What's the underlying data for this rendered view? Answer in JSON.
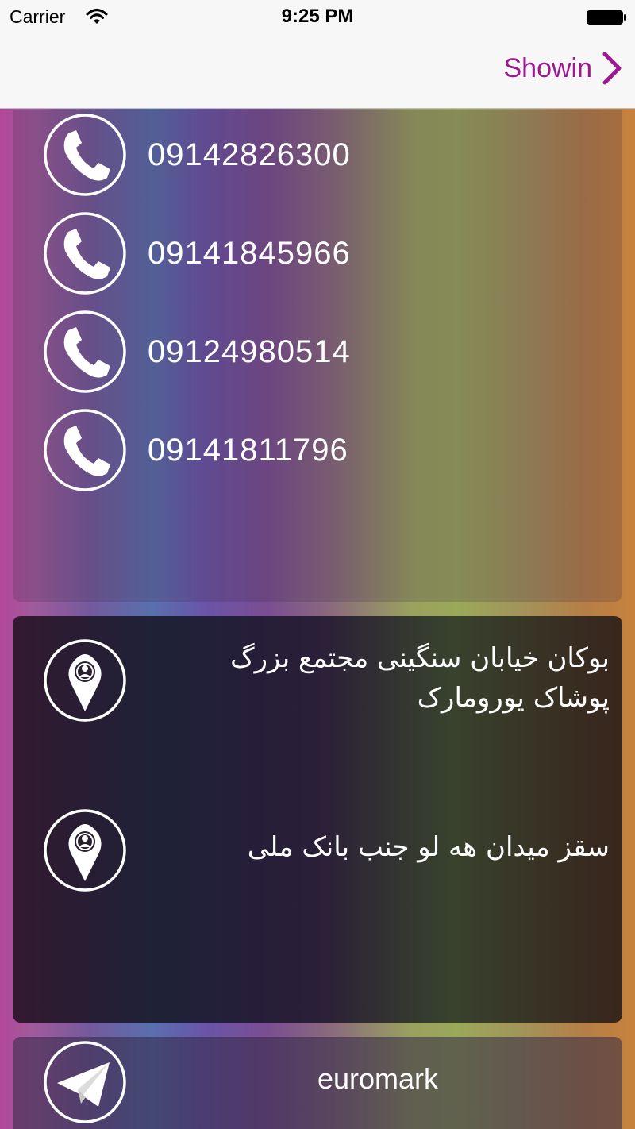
{
  "status_bar": {
    "carrier": "Carrier",
    "time": "9:25 PM"
  },
  "nav": {
    "forward_label": "Showin"
  },
  "phones": [
    {
      "number": "09142826300",
      "icon": "phone-icon"
    },
    {
      "number": "09141845966",
      "icon": "phone-icon"
    },
    {
      "number": "09124980514",
      "icon": "phone-icon"
    },
    {
      "number": "09141811796",
      "icon": "phone-icon"
    }
  ],
  "addresses": [
    {
      "text": "بوکان خیابان سنگینی مجتمع بزرگ پوشاک یورومارک",
      "icon": "location-pin-icon"
    },
    {
      "text": "سقز میدان هه لو جنب بانک ملی",
      "icon": "location-pin-icon"
    }
  ],
  "social": {
    "label": "euromark",
    "icon": "telegram-icon"
  },
  "colors": {
    "accent": "#9b1b8f",
    "text_on_card": "#ffffff"
  }
}
